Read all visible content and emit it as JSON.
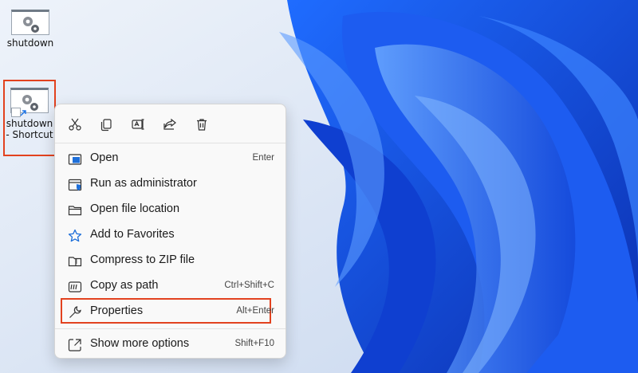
{
  "desktop": {
    "icons": [
      {
        "label": "shutdown"
      },
      {
        "label": "shutdown - Shortcut"
      }
    ]
  },
  "context_menu": {
    "toolbar": [
      "cut-icon",
      "copy-icon",
      "rename-icon",
      "share-icon",
      "delete-icon"
    ],
    "items": [
      {
        "label": "Open",
        "shortcut": "Enter",
        "icon": "open-icon"
      },
      {
        "label": "Run as administrator",
        "shortcut": "",
        "icon": "shield-icon"
      },
      {
        "label": "Open file location",
        "shortcut": "",
        "icon": "folder-icon"
      },
      {
        "label": "Add to Favorites",
        "shortcut": "",
        "icon": "star-icon"
      },
      {
        "label": "Compress to ZIP file",
        "shortcut": "",
        "icon": "zip-icon"
      },
      {
        "label": "Copy as path",
        "shortcut": "Ctrl+Shift+C",
        "icon": "copy-path-icon"
      },
      {
        "label": "Properties",
        "shortcut": "Alt+Enter",
        "icon": "wrench-icon",
        "highlighted": true
      },
      {
        "label": "Show more options",
        "shortcut": "Shift+F10",
        "icon": "more-options-icon"
      }
    ]
  },
  "colors": {
    "highlight": "#e2421f",
    "accent": "#0067c0",
    "wallpaper": "#1454e0"
  }
}
